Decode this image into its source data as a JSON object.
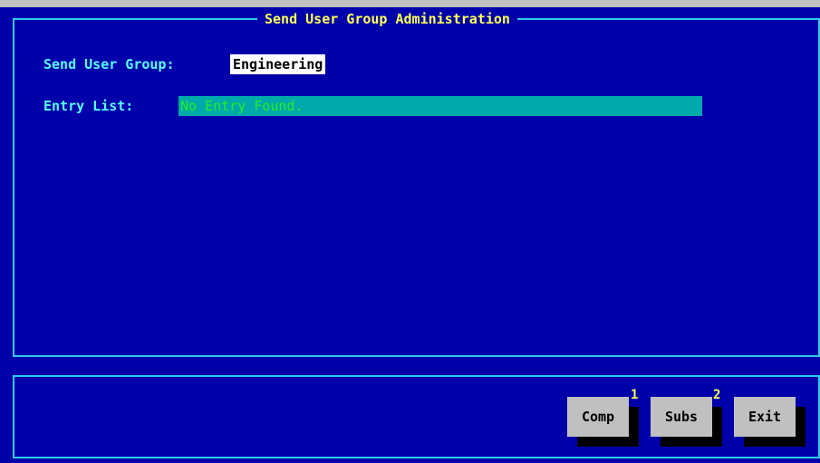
{
  "window": {
    "title": "Send User Group Administration"
  },
  "form": {
    "group_label": "Send User Group:",
    "group_value": "Engineering",
    "entry_label": "Entry List:",
    "entry_value": "No Entry Found."
  },
  "buttons": [
    {
      "label": "Comp",
      "hotkey": "1"
    },
    {
      "label": "Subs",
      "hotkey": "2"
    },
    {
      "label": "Exit",
      "hotkey": ""
    }
  ],
  "colors": {
    "background": "#0000aa",
    "frame": "#2ec8e8",
    "title": "#ffff55",
    "label": "#55ffff",
    "list_background": "#00aaaa",
    "list_text": "#22ee22",
    "button_face": "#c0c0c0"
  }
}
